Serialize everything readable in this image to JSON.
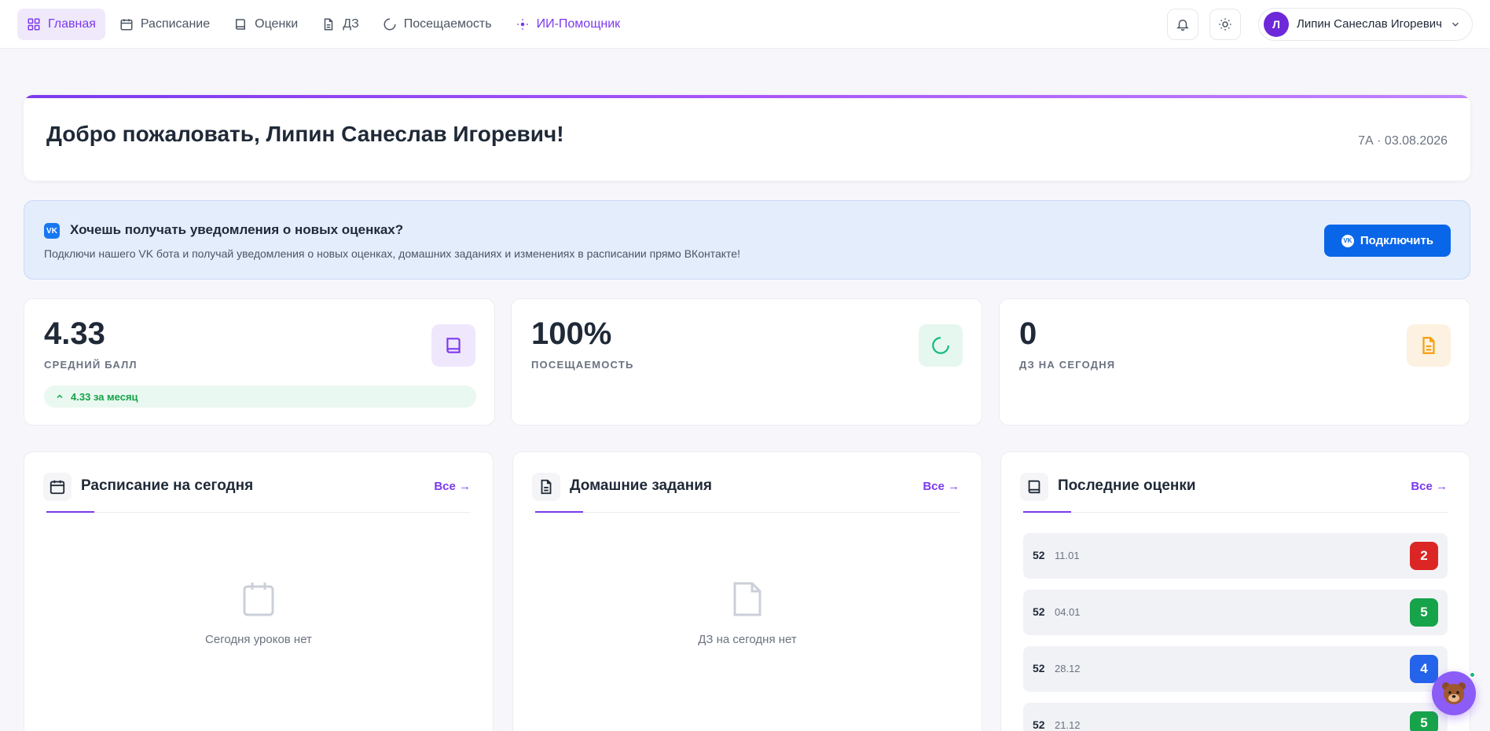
{
  "nav": {
    "items": [
      {
        "label": "Главная",
        "icon": "dashboard-grid-icon"
      },
      {
        "label": "Расписание",
        "icon": "calendar-icon"
      },
      {
        "label": "Оценки",
        "icon": "book-icon"
      },
      {
        "label": "ДЗ",
        "icon": "document-icon"
      },
      {
        "label": "Посещаемость",
        "icon": "progress-ring-icon"
      },
      {
        "label": "ИИ-Помощник",
        "icon": "sparkle-icon"
      }
    ],
    "active_index": 0
  },
  "user": {
    "initial": "Л",
    "name": "Липин Санеслав Игоревич"
  },
  "welcome": {
    "title": "Добро пожаловать, Липин Санеслав Игоревич!",
    "meta": "7А · 03.08.2026"
  },
  "vk_banner": {
    "title": "Хочешь получать уведомления о новых оценках?",
    "description": "Подключи нашего VK бота и получай уведомления о новых оценках, домашних заданиях и изменениях в расписании прямо ВКонтакте!",
    "button_label": "Подключить"
  },
  "stats": {
    "average": {
      "value": "4.33",
      "label": "СРЕДНИЙ БАЛЛ",
      "trend": "4.33 за месяц"
    },
    "attendance": {
      "value": "100%",
      "label": "ПОСЕЩАЕМОСТЬ"
    },
    "homework": {
      "value": "0",
      "label": "ДЗ НА СЕГОДНЯ"
    }
  },
  "panels": {
    "schedule": {
      "title": "Расписание на сегодня",
      "all_label": "Все →",
      "empty_text": "Сегодня уроков нет"
    },
    "homework": {
      "title": "Домашние задания",
      "all_label": "Все →",
      "empty_text": "ДЗ на сегодня нет"
    },
    "grades": {
      "title": "Последние оценки",
      "all_label": "Все →",
      "rows": [
        {
          "subject": "52",
          "date": "11.01",
          "grade": "2",
          "color": "#dc2626"
        },
        {
          "subject": "52",
          "date": "04.01",
          "grade": "5",
          "color": "#16a34a"
        },
        {
          "subject": "52",
          "date": "28.12",
          "grade": "4",
          "color": "#2563eb"
        },
        {
          "subject": "52",
          "date": "21.12",
          "grade": "5",
          "color": "#16a34a"
        }
      ]
    }
  },
  "colors": {
    "accent": "#7c3aed",
    "vk_blue": "#0a66e8"
  }
}
